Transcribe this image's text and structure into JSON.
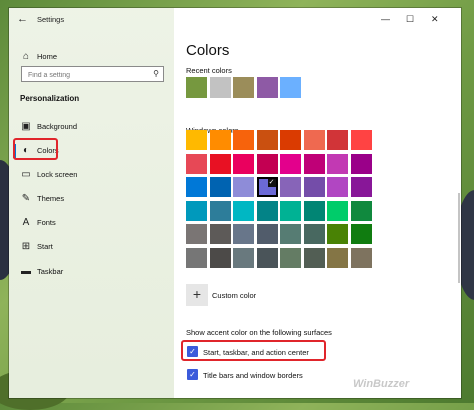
{
  "window": {
    "title": "Settings",
    "back": "←",
    "minimize": "—",
    "maximize": "☐",
    "close": "✕"
  },
  "sidebar": {
    "home": "Home",
    "search_placeholder": "Find a setting",
    "section": "Personalization",
    "items": [
      {
        "label": "Background",
        "icon": "picture-icon"
      },
      {
        "label": "Colors",
        "icon": "palette-icon",
        "selected": true
      },
      {
        "label": "Lock screen",
        "icon": "monitor-icon"
      },
      {
        "label": "Themes",
        "icon": "brush-icon"
      },
      {
        "label": "Fonts",
        "icon": "font-icon"
      },
      {
        "label": "Start",
        "icon": "start-icon"
      },
      {
        "label": "Taskbar",
        "icon": "taskbar-icon"
      }
    ]
  },
  "main": {
    "title": "Colors",
    "recent_label": "Recent colors",
    "recent_colors": [
      "#76983f",
      "#c2c2c2",
      "#9b8d5a",
      "#8e5aa5",
      "#6bb0ff"
    ],
    "windows_label": "Windows colors",
    "windows_colors": [
      [
        "#ffb900",
        "#ff8c00",
        "#f7630c",
        "#ca5010",
        "#da3b01",
        "#ef6950",
        "#d13438",
        "#ff4343"
      ],
      [
        "#e74856",
        "#e81123",
        "#ea005e",
        "#c30052",
        "#e3008c",
        "#bf0077",
        "#c239b3",
        "#9a0089"
      ],
      [
        "#0078d7",
        "#0063b1",
        "#8e8cd8",
        "#6b69d6",
        "#8764b8",
        "#744da9",
        "#b146c2",
        "#881798"
      ],
      [
        "#0099bc",
        "#2d7d9a",
        "#00b7c3",
        "#038387",
        "#00b294",
        "#018574",
        "#00cc6a",
        "#10893e"
      ],
      [
        "#7a7574",
        "#5d5a58",
        "#68768a",
        "#515c6b",
        "#567c73",
        "#486860",
        "#498205",
        "#107c10"
      ],
      [
        "#767676",
        "#4c4a48",
        "#69797e",
        "#4a5459",
        "#647c64",
        "#525e54",
        "#847545",
        "#7e735f"
      ]
    ],
    "selected_color": {
      "row": 2,
      "col": 3,
      "mark": "✓"
    },
    "custom_label": "Custom color",
    "custom_icon": "+",
    "accent_heading": "Show accent color on the following surfaces",
    "checkboxes": [
      {
        "label": "Start, taskbar, and action center",
        "checked": true
      },
      {
        "label": "Title bars and window borders",
        "checked": true
      }
    ]
  },
  "watermark": "WinBuzzer",
  "colors": {
    "accent": "#0078d7",
    "highlight": "#e0252b",
    "checkbox": "#3b5bdb"
  }
}
